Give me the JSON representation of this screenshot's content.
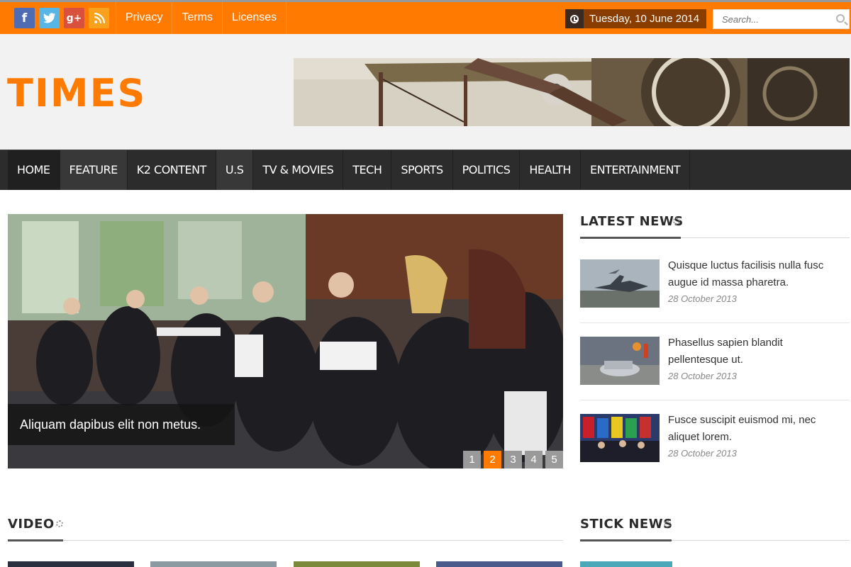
{
  "topbar": {
    "social": [
      {
        "name": "facebook-icon",
        "glyph": "f"
      },
      {
        "name": "twitter-icon",
        "glyph": "t"
      },
      {
        "name": "google-plus-icon",
        "glyph": "g+"
      },
      {
        "name": "rss-icon",
        "glyph": ")"
      }
    ],
    "links": [
      "Privacy",
      "Terms",
      "Licenses"
    ],
    "date": "Tuesday, 10 June 2014",
    "search_placeholder": "Search..."
  },
  "header": {
    "logo": "TIMES"
  },
  "nav": {
    "items": [
      "HOME",
      "FEATURE",
      "K2 CONTENT",
      "U.S",
      "TV & MOVIES",
      "TECH",
      "SPORTS",
      "POLITICS",
      "HEALTH",
      "ENTERTAINMENT"
    ]
  },
  "slider": {
    "caption": "Aliquam dapibus elit non metus.",
    "pages": [
      "1",
      "2",
      "3",
      "4",
      "5"
    ],
    "active_page": "2"
  },
  "latest_news": {
    "title": "LATEST NEWS",
    "items": [
      {
        "title": "Quisque luctus facilisis nulla fusc augue id massa pharetra.",
        "date": "28 October 2013"
      },
      {
        "title": "Phasellus sapien blandit pellentesque ut.",
        "date": "28 October 2013"
      },
      {
        "title": "Fusce suscipit euismod mi, nec aliquet lorem.",
        "date": "28 October 2013"
      }
    ]
  },
  "video": {
    "title": "VIDEO"
  },
  "stick_news": {
    "title": "STICK NEWS"
  },
  "colors": {
    "accent": "#ff7a00",
    "nav_bg": "#2c2c2c",
    "header_bg": "#f2f2f2"
  }
}
